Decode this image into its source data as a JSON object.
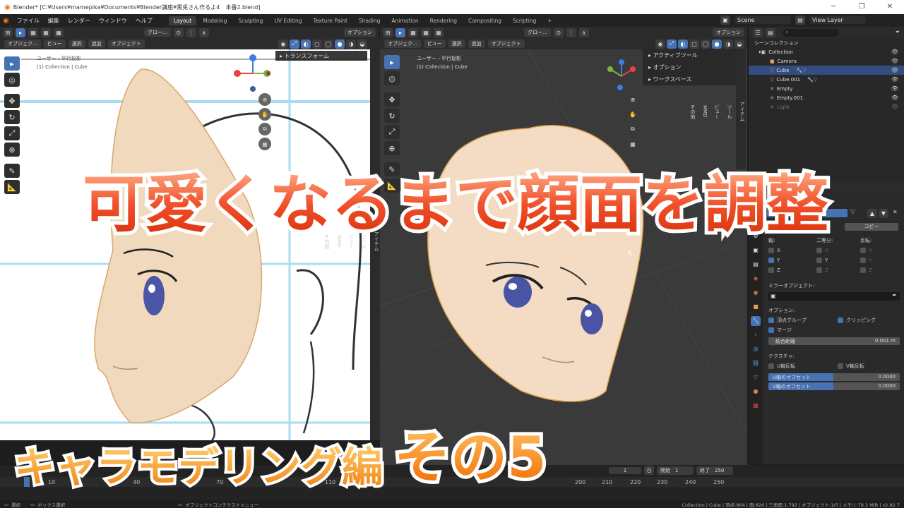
{
  "titlebar": {
    "title": "Blender* [C:¥Users¥mamepika¥Documents¥Blender講座¥黒兎さん作るよ4　本番2.blend]",
    "min": "─",
    "max": "❐",
    "close": "✕"
  },
  "menu": {
    "items": [
      "ファイル",
      "編集",
      "レンダー",
      "ウィンドウ",
      "ヘルプ"
    ],
    "workspaces": [
      "Layout",
      "Modeling",
      "Sculpting",
      "UV Editing",
      "Texture Paint",
      "Shading",
      "Animation",
      "Rendering",
      "Compositing",
      "Scripting"
    ],
    "add_tab": "+",
    "scene": "Scene",
    "view_layer": "View Layer"
  },
  "left_view": {
    "header": {
      "transform": "グロー...",
      "option": "オプション"
    },
    "sub": {
      "mode": "オブジェク...",
      "view": "ビュー",
      "select": "選択",
      "add": "追加",
      "object": "オブジェクト"
    },
    "info_line1": "ユーザー・平行投影",
    "info_line2": "(1) Collection | Cube",
    "npanel_title": "トランスフォーム",
    "side_tabs": [
      "アイテム",
      "ツール",
      "ビュー",
      "MMD",
      "その他"
    ]
  },
  "right_view": {
    "header": {
      "transform": "グロー...",
      "option": "オプション"
    },
    "sub": {
      "mode": "オブジェク...",
      "view": "ビュー",
      "select": "選択",
      "add": "追加",
      "object": "オブジェクト"
    },
    "info_line1": "ユーザー・平行投影",
    "info_line2": "(1) Collection | Cube",
    "npanel": [
      "アクティブツール",
      "オプション",
      "ワークスペース"
    ],
    "side_tabs": [
      "アイテム",
      "ツール",
      "ビュー",
      "MMD",
      "その他"
    ]
  },
  "outliner": {
    "title": "シーンコレクション",
    "rows": [
      {
        "label": "Collection"
      },
      {
        "label": "Camera"
      },
      {
        "label": "Cube"
      },
      {
        "label": "Cube.001"
      },
      {
        "label": "Empty"
      },
      {
        "label": "Empty.001"
      },
      {
        "label": "Light"
      }
    ]
  },
  "properties": {
    "copy": "コピー",
    "axis_label": "軸:",
    "bisect_label": "二等分:",
    "flip_label": "反転:",
    "axes": [
      "X",
      "Y",
      "Z"
    ],
    "mirror_object": "ミラーオブジェクト:",
    "options_label": "オプション:",
    "vertex_groups": "頂点グループ",
    "clipping": "クリッピング",
    "merge": "マージ",
    "merge_distance_label": "結合距離",
    "merge_distance_value": "0.001 m",
    "texture_label": "テクスチャ:",
    "u_flip": "U軸反転",
    "v_flip": "V軸反転",
    "u_offset_label": "U軸のオフセット",
    "u_offset_value": "0.0000",
    "v_offset_label": "V軸のオフセット",
    "v_offset_value": "0.0000"
  },
  "timeline": {
    "current_frame": "1",
    "start_label": "開始",
    "start_value": "1",
    "end_label": "終了",
    "end_value": "250",
    "ticks": [
      "10",
      "40",
      "70",
      "110",
      "200",
      "210",
      "220",
      "230",
      "240",
      "250"
    ]
  },
  "status": {
    "select": "選択",
    "box_select": "ボックス選択",
    "context_menu": "オブジェクトコンテクストメニュー",
    "stats": "Collection | Cube | 頂点:964 | 面:826 | 三角面:1,792 | オブジェクト:1/5 | メモリ:78.2 MiB | v2.82.7"
  },
  "overlay": {
    "title": "可愛くなるまで顔面を調整",
    "subtitle": "キャラモデリング編",
    "part": "その5"
  }
}
